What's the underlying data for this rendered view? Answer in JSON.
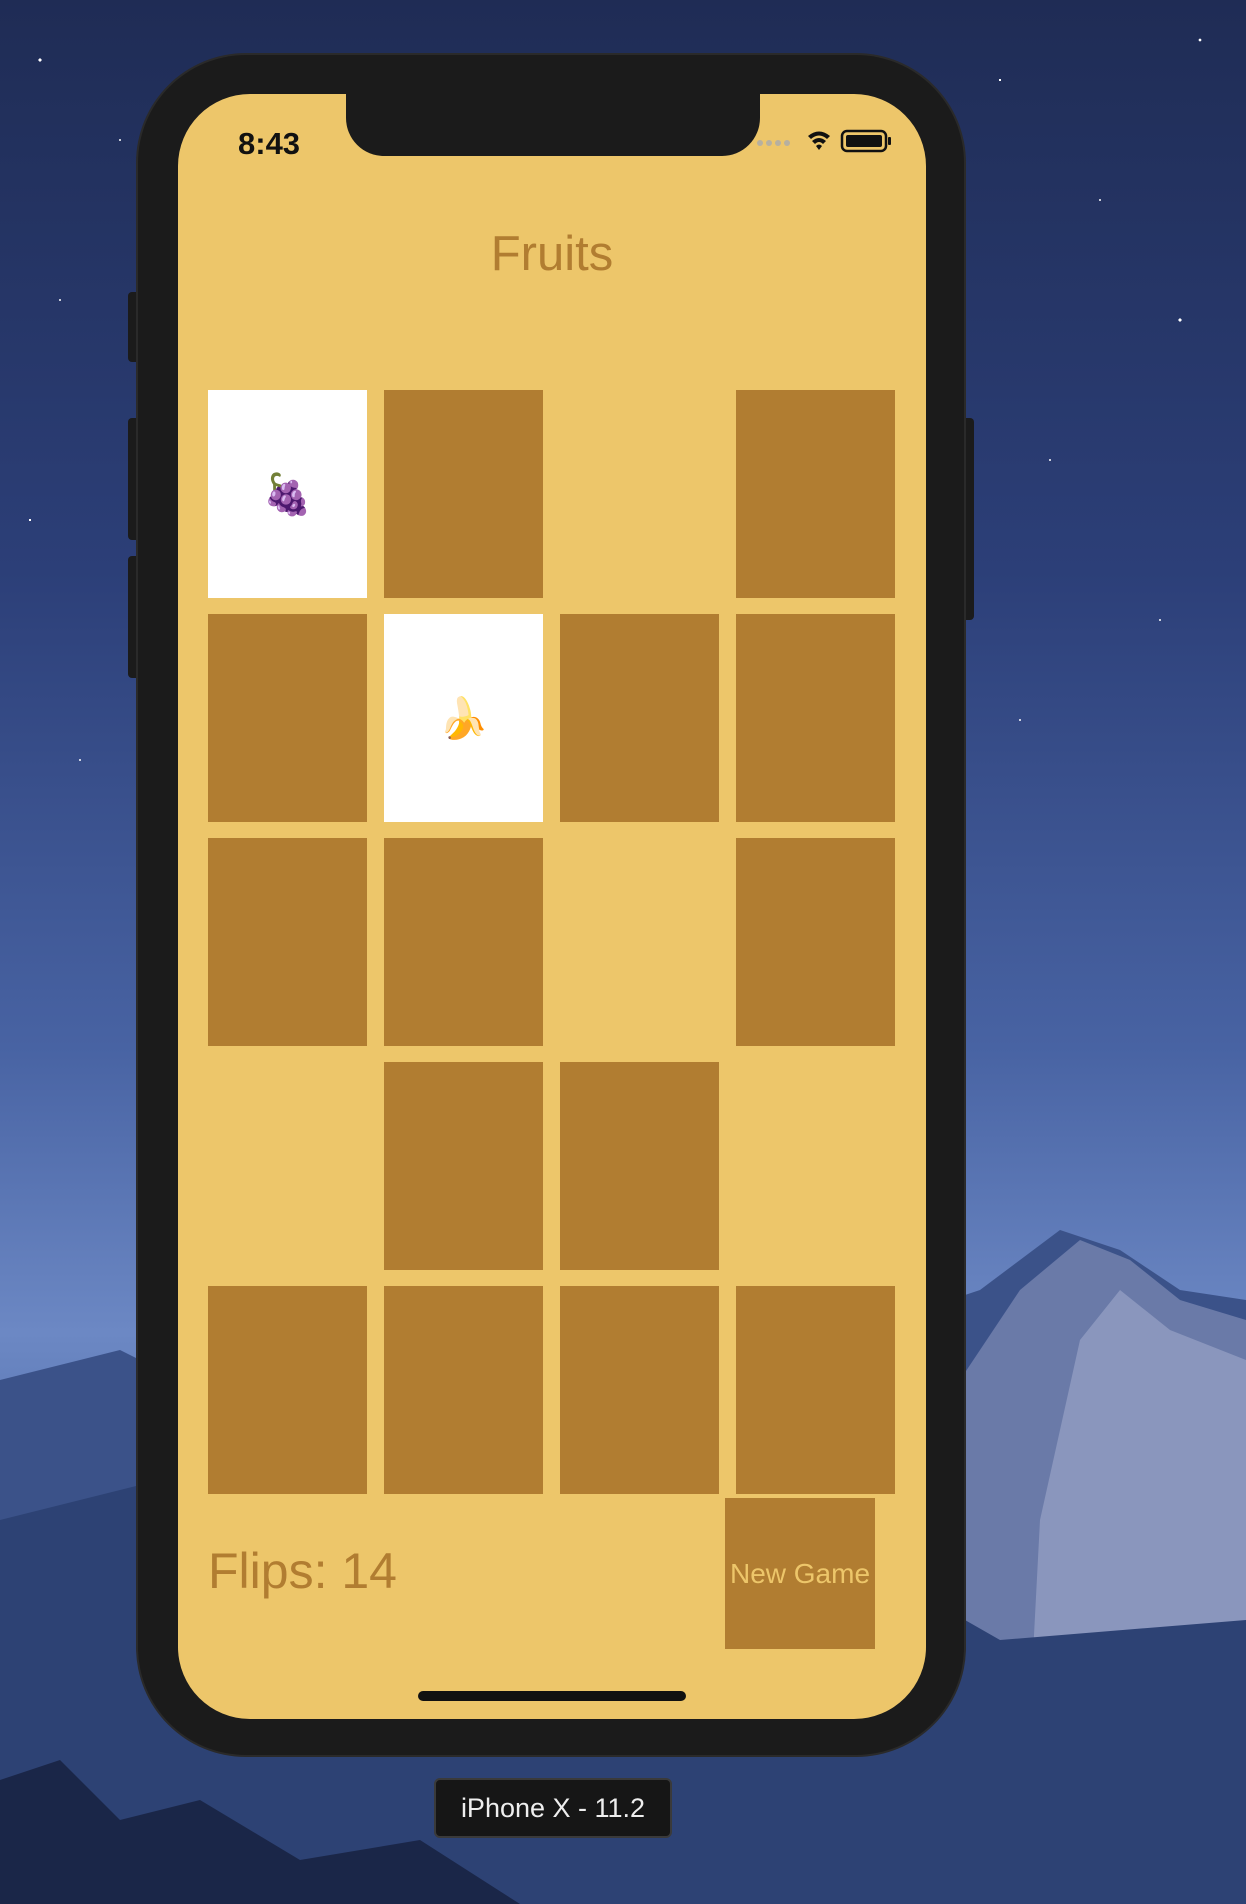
{
  "status_bar": {
    "time": "8:43",
    "icons": [
      "signal-dots-icon",
      "wifi-icon",
      "battery-icon"
    ]
  },
  "app": {
    "title": "Fruits",
    "flips_label": "Flips: 14",
    "new_game_label": "New Game"
  },
  "cards": [
    {
      "state": "up",
      "emoji": "🍇"
    },
    {
      "state": "down",
      "emoji": ""
    },
    {
      "state": "gone",
      "emoji": ""
    },
    {
      "state": "down",
      "emoji": ""
    },
    {
      "state": "down",
      "emoji": ""
    },
    {
      "state": "up",
      "emoji": "🍌"
    },
    {
      "state": "down",
      "emoji": ""
    },
    {
      "state": "down",
      "emoji": ""
    },
    {
      "state": "down",
      "emoji": ""
    },
    {
      "state": "down",
      "emoji": ""
    },
    {
      "state": "gone",
      "emoji": ""
    },
    {
      "state": "down",
      "emoji": ""
    },
    {
      "state": "gone",
      "emoji": ""
    },
    {
      "state": "down",
      "emoji": ""
    },
    {
      "state": "down",
      "emoji": ""
    },
    {
      "state": "gone",
      "emoji": ""
    },
    {
      "state": "down",
      "emoji": ""
    },
    {
      "state": "down",
      "emoji": ""
    },
    {
      "state": "down",
      "emoji": ""
    },
    {
      "state": "down",
      "emoji": ""
    }
  ],
  "simulator": {
    "device_label": "iPhone X - 11.2"
  },
  "colors": {
    "screen_background": "#edc66a",
    "card_back": "#b17d31",
    "card_face": "#ffffff"
  }
}
